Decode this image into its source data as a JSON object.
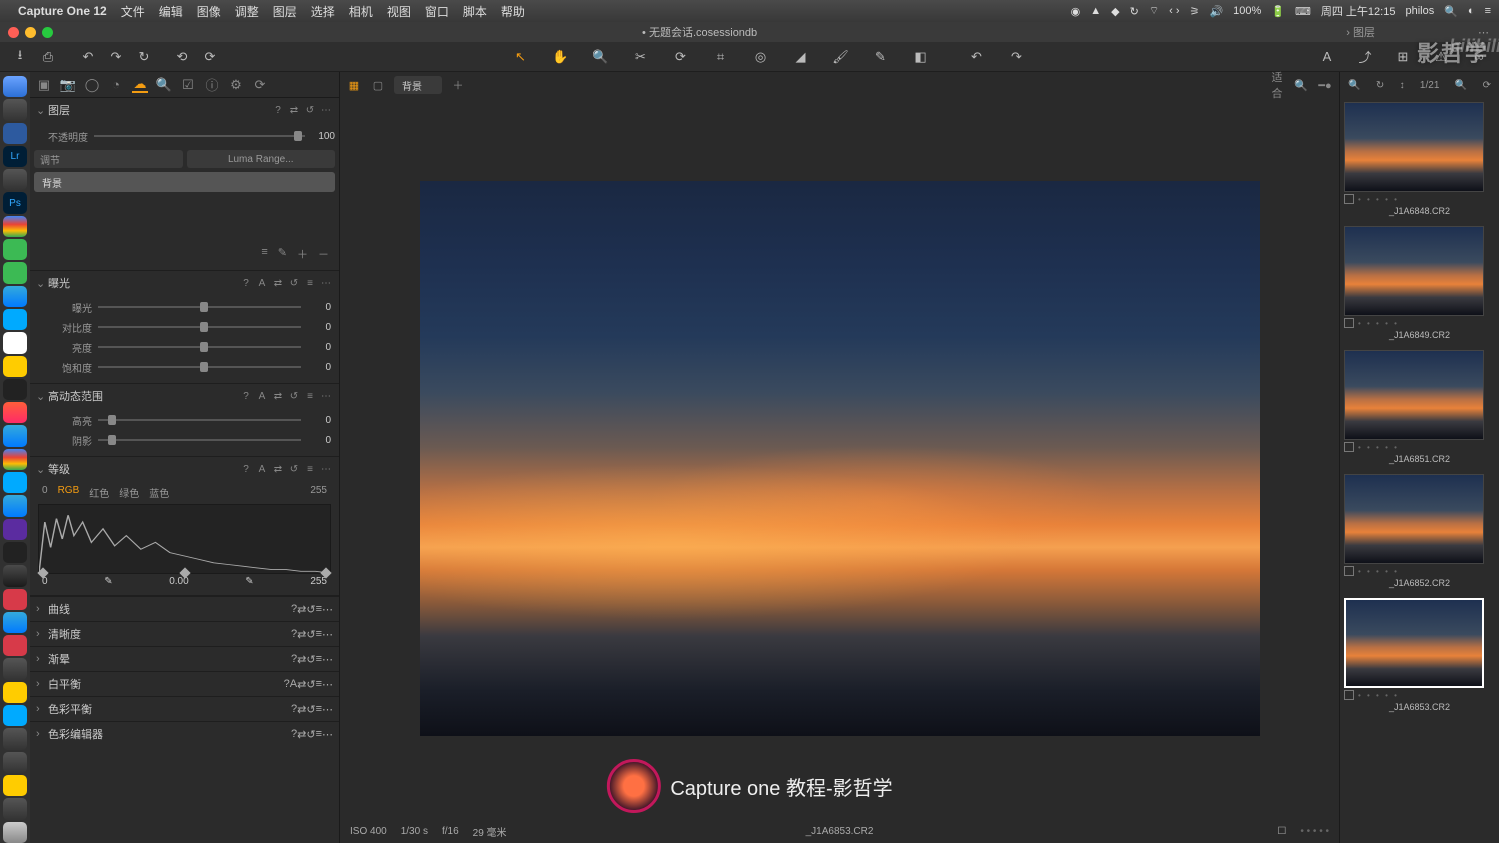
{
  "menubar": {
    "app": "Capture One 12",
    "items": [
      "文件",
      "编辑",
      "图像",
      "调整",
      "图层",
      "选择",
      "相机",
      "视图",
      "窗口",
      "脚本",
      "帮助"
    ],
    "battery": "100%",
    "clock": "周四 上午12:15",
    "user": "philos"
  },
  "window": {
    "title": "无题会话.cosessiondb",
    "breadcrumb_icon": "›",
    "breadcrumb": "图层"
  },
  "viewer_toolbar": {
    "layer_dropdown": "背景",
    "fit_label": "适合",
    "counter": "1/21"
  },
  "panels": {
    "layers": {
      "title": "图层",
      "opacity_label": "不透明度",
      "opacity_value": "100",
      "adjust_label": "调节",
      "luma_label": "Luma Range...",
      "selected_layer": "背景"
    },
    "exposure": {
      "title": "曝光",
      "rows": [
        {
          "label": "曝光",
          "value": "0",
          "pos": 50
        },
        {
          "label": "对比度",
          "value": "0",
          "pos": 50
        },
        {
          "label": "亮度",
          "value": "0",
          "pos": 50
        },
        {
          "label": "饱和度",
          "value": "0",
          "pos": 50
        }
      ]
    },
    "hdr": {
      "title": "高动态范围",
      "rows": [
        {
          "label": "高亮",
          "value": "0",
          "pos": 5
        },
        {
          "label": "阴影",
          "value": "0",
          "pos": 5
        }
      ]
    },
    "levels": {
      "title": "等级",
      "low": "0",
      "high": "255",
      "tabs": [
        "RGB",
        "红色",
        "绿色",
        "蓝色"
      ],
      "out_low": "0",
      "out_mid": "0.00",
      "out_high": "255"
    },
    "collapsed": [
      "曲线",
      "清晰度",
      "渐晕",
      "白平衡",
      "色彩平衡",
      "色彩编辑器"
    ]
  },
  "viewer_footer": {
    "iso": "ISO 400",
    "shutter": "1/30 s",
    "aperture": "f/16",
    "focal": "29 毫米",
    "filename": "_J1A6853.CR2"
  },
  "thumbnails": [
    {
      "name": "_J1A6848.CR2"
    },
    {
      "name": "_J1A6849.CR2"
    },
    {
      "name": "_J1A6851.CR2"
    },
    {
      "name": "_J1A6852.CR2"
    },
    {
      "name": "_J1A6853.CR2",
      "selected": true
    }
  ],
  "watermark": {
    "right": "影哲学",
    "bili": "bilibili",
    "bottom": "Capture one 教程-影哲学"
  }
}
